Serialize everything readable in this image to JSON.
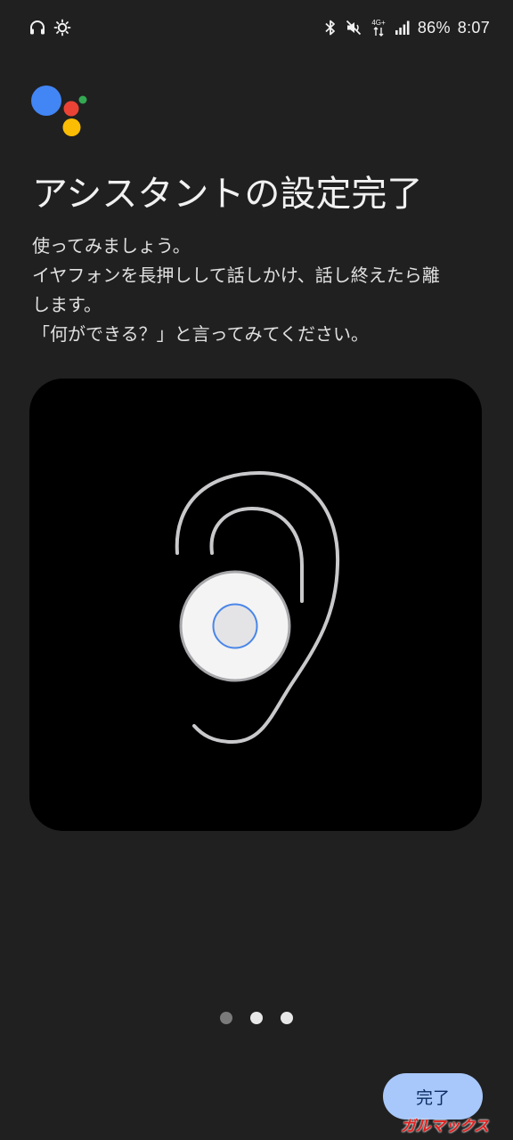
{
  "status_bar": {
    "left_icons": [
      "headphones-icon",
      "brightness-icon"
    ],
    "right_icons": [
      "bluetooth-icon",
      "mute-icon",
      "4g-data-icon",
      "signal-icon"
    ],
    "network_label": "4G+",
    "battery": "86%",
    "time": "8:07"
  },
  "logo": {
    "icon": "google-assistant-logo",
    "colors": {
      "blue": "#4285F4",
      "red": "#EA4335",
      "yellow": "#FBBC04",
      "green": "#34A853"
    }
  },
  "page": {
    "title": "アシスタントの設定完了",
    "description": [
      "使ってみましょう。",
      "イヤフォンを長押しして話しかけ、話し終えたら離",
      "します。",
      "「何ができる？」と言ってみてください。"
    ]
  },
  "illustration": {
    "icon": "ear-with-earbud-icon",
    "accent": "#4a86e8"
  },
  "pager": {
    "current_page": 1,
    "total_pages": 3
  },
  "actions": {
    "done_label": "完了"
  },
  "watermark": "ガルマックス",
  "colors": {
    "background": "#202020",
    "button": "#a8c7fa",
    "button_text": "#0b2c63"
  }
}
